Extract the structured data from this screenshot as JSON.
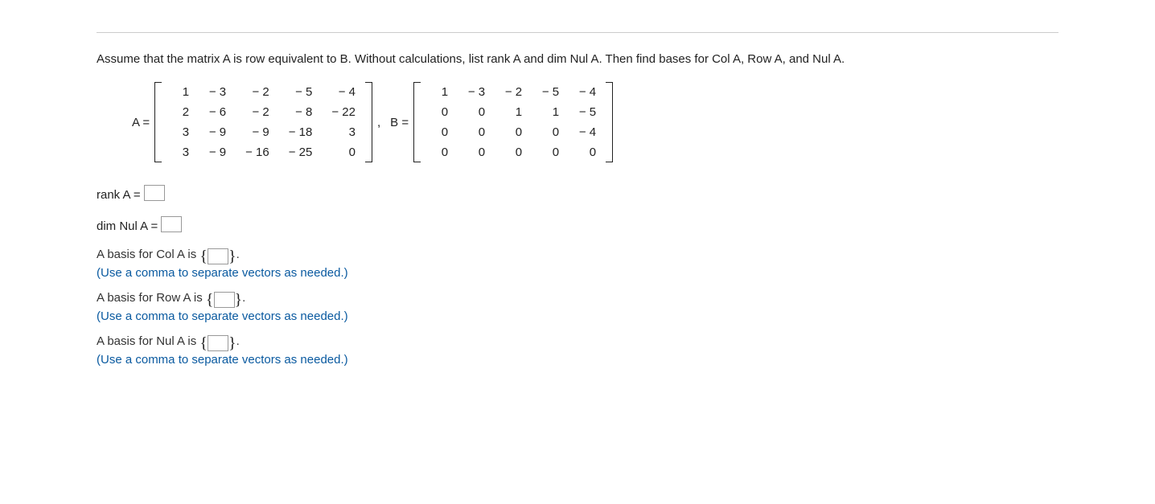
{
  "question": "Assume that the matrix A is row equivalent to B. Without calculations, list rank A and dim Nul A. Then find bases for Col A, Row A, and Nul A.",
  "labelA": "A =",
  "labelComma": ",",
  "labelB": "B =",
  "matrixA": [
    [
      "1",
      "− 3",
      "− 2",
      "− 5",
      "− 4"
    ],
    [
      "2",
      "− 6",
      "− 2",
      "− 8",
      "− 22"
    ],
    [
      "3",
      "− 9",
      "− 9",
      "− 18",
      "3"
    ],
    [
      "3",
      "− 9",
      "− 16",
      "− 25",
      "0"
    ]
  ],
  "matrixB": [
    [
      "1",
      "− 3",
      "− 2",
      "− 5",
      "− 4"
    ],
    [
      "0",
      "0",
      "1",
      "1",
      "− 5"
    ],
    [
      "0",
      "0",
      "0",
      "0",
      "− 4"
    ],
    [
      "0",
      "0",
      "0",
      "0",
      "0"
    ]
  ],
  "rankLabel": "rank A =",
  "dimNulLabel": "dim Nul A =",
  "colBasis": "A basis for Col A is ",
  "rowBasis": "A basis for Row A is ",
  "nulBasis": "A basis for Nul A is ",
  "period": ".",
  "hint": "(Use a comma to separate vectors as needed.)"
}
